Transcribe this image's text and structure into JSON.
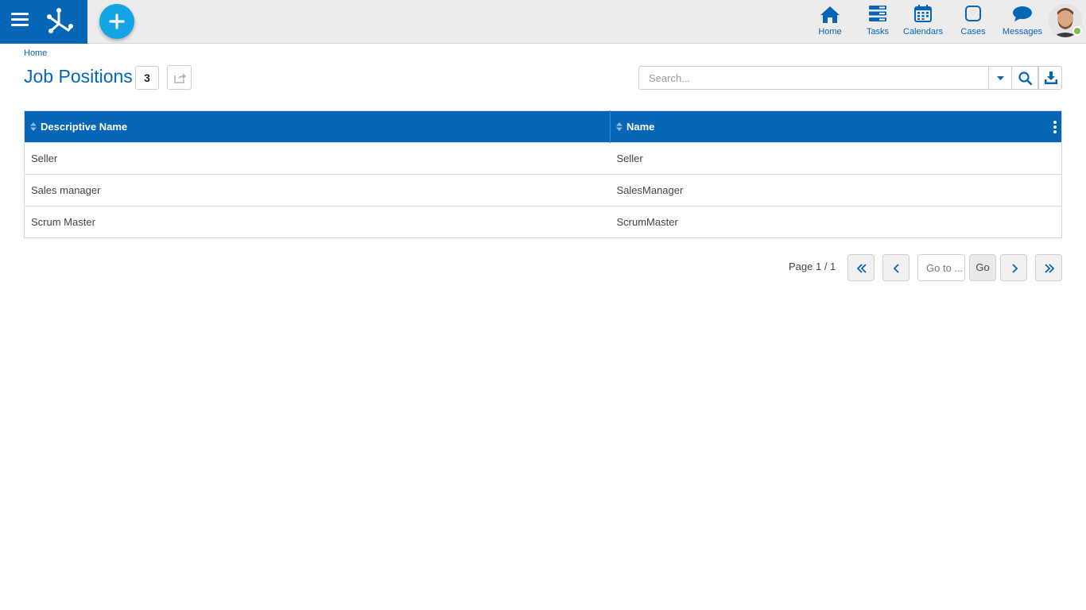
{
  "colors": {
    "brand": "#0565b6",
    "fab": "#13a4e6",
    "online": "#7cc142"
  },
  "topbar": {
    "nav": [
      {
        "label": "Home",
        "icon": "home-icon"
      },
      {
        "label": "Tasks",
        "icon": "tasks-icon"
      },
      {
        "label": "Calendars",
        "icon": "calendar-icon"
      },
      {
        "label": "Cases",
        "icon": "cases-icon"
      },
      {
        "label": "Messages",
        "icon": "messages-icon"
      }
    ]
  },
  "breadcrumb": "Home",
  "page": {
    "title": "Job Positions",
    "count": "3"
  },
  "search": {
    "placeholder": "Search..."
  },
  "table": {
    "columns": [
      "Descriptive Name",
      "Name"
    ],
    "rows": [
      [
        "Seller",
        "Seller"
      ],
      [
        "Sales manager",
        "SalesManager"
      ],
      [
        "Scrum Master",
        "ScrumMaster"
      ]
    ]
  },
  "pagination": {
    "info": "Page 1 / 1",
    "goto_placeholder": "Go to ...",
    "go_label": "Go"
  }
}
